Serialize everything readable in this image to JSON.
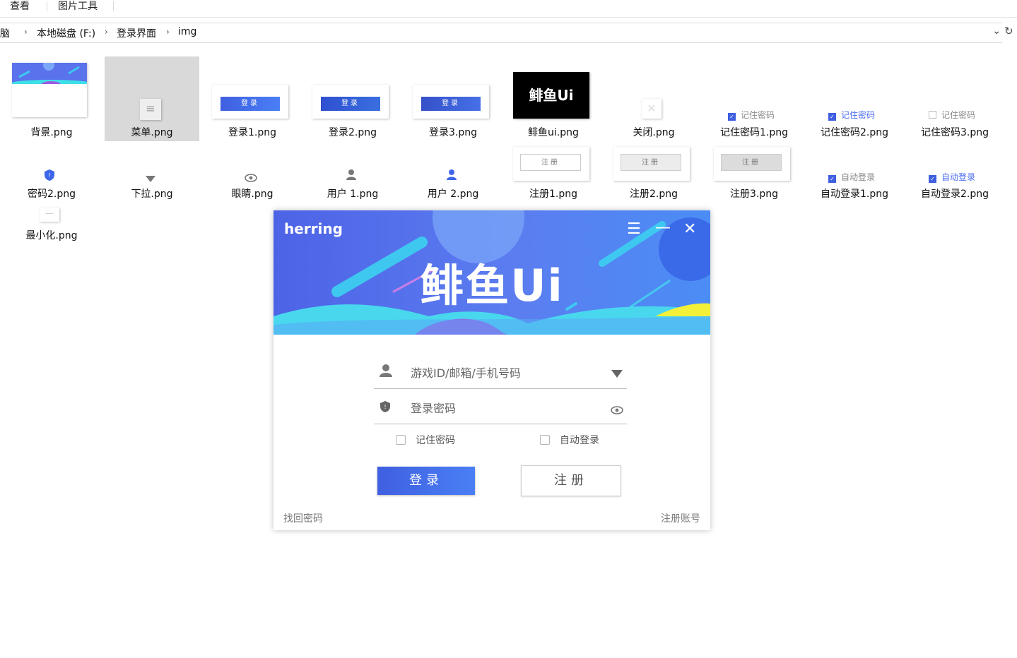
{
  "ribbon": {
    "tabs": [
      "查看",
      "图片工具"
    ]
  },
  "address": {
    "crumbs": [
      "电脑",
      "本地磁盘 (F:)",
      "登录界面",
      "img"
    ]
  },
  "files": [
    "背景.png",
    "菜单.png",
    "登录1.png",
    "登录2.png",
    "登录3.png",
    "鲱鱼ui.png",
    "关闭.png",
    "记住密码1.png",
    "记住密码2.png",
    "记住密码3.png",
    "密码2.png",
    "下拉.png",
    "眼睛.png",
    "用户 1.png",
    "用户 2.png",
    "注册1.png",
    "注册2.png",
    "注册3.png",
    "自动登录1.png",
    "自动登录2.png",
    "最小化.png"
  ],
  "thumbs": {
    "login_label": "登录",
    "register_label": "注册",
    "logo_text": "鲱鱼Ui",
    "remember_label": "记住密码",
    "auto_label": "自动登录"
  },
  "login_window": {
    "brand": "herring",
    "logo": "鲱鱼Ui",
    "account_placeholder": "游戏ID/邮箱/手机号码",
    "password_placeholder": "登录密码",
    "remember": "记住密码",
    "auto_login": "自动登录",
    "login_button": "登录",
    "register_button": "注册",
    "forgot": "找回密码",
    "register_account": "注册账号"
  },
  "colors": {
    "accent": "#4a6cf0",
    "banner_dark": "#4d63e6",
    "teal": "#3ee0e8",
    "yellow": "#f3f03a"
  }
}
